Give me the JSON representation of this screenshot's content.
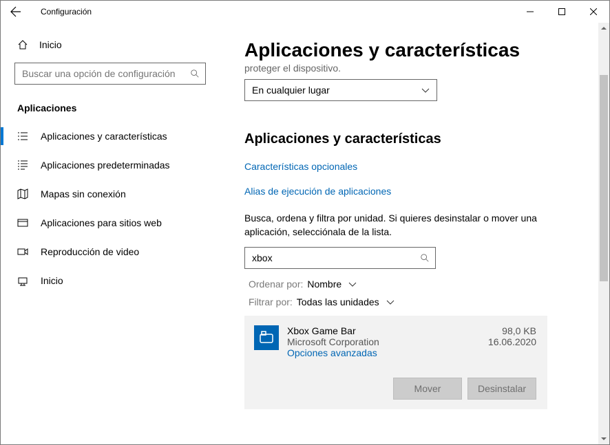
{
  "window": {
    "title": "Configuración"
  },
  "sidebar": {
    "home": "Inicio",
    "search_placeholder": "Buscar una opción de configuración",
    "section": "Aplicaciones",
    "items": [
      {
        "label": "Aplicaciones y características"
      },
      {
        "label": "Aplicaciones predeterminadas"
      },
      {
        "label": "Mapas sin conexión"
      },
      {
        "label": "Aplicaciones para sitios web"
      },
      {
        "label": "Reproducción de video"
      },
      {
        "label": "Inicio"
      }
    ]
  },
  "main": {
    "heading": "Aplicaciones y características",
    "truncated": "proteger el dispositivo.",
    "source_dropdown": "En cualquier lugar",
    "subheading": "Aplicaciones y características",
    "link_optional": "Características opcionales",
    "link_alias": "Alias de ejecución de aplicaciones",
    "description": "Busca, ordena y filtra por unidad. Si quieres desinstalar o mover una aplicación, selecciónala de la lista.",
    "filter_value": "xbox",
    "sort_label": "Ordenar por:",
    "sort_value": "Nombre",
    "filter_label": "Filtrar por:",
    "filter_by_value": "Todas las unidades",
    "app": {
      "name": "Xbox Game Bar",
      "publisher": "Microsoft Corporation",
      "advanced": "Opciones avanzadas",
      "size": "98,0 KB",
      "date": "16.06.2020",
      "move": "Mover",
      "uninstall": "Desinstalar"
    }
  }
}
